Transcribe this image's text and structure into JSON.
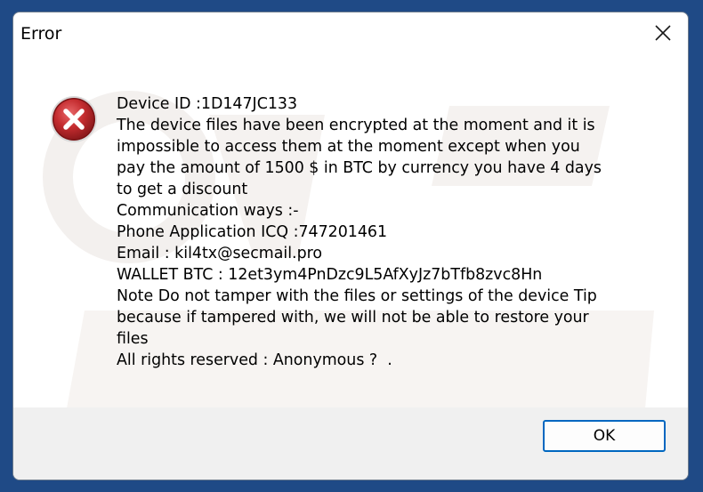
{
  "window": {
    "title": "Error",
    "close_icon": "close-icon"
  },
  "icon": {
    "name": "error-icon",
    "color": "#b3262a"
  },
  "message": {
    "lines": [
      "Device ID :1D147JC133",
      "The device files have been encrypted at the moment and it is",
      "impossible to access them at the moment except when you",
      "pay the amount of 1500 $ in BTC by currency you have 4 days",
      "to get a discount",
      "Communication ways :-",
      "Phone Application ICQ :747201461",
      "Email : kil4tx@secmail.pro",
      "WALLET BTC : 12et3ym4PnDzc9L5AfXyJz7bTfb8zvc8Hn",
      "Note Do not tamper with the files or settings of the device Tip",
      "because if tampered with, we will not be able to restore your",
      "files",
      "All rights reserved : Anonymous ?  ."
    ]
  },
  "buttons": {
    "ok_label": "OK"
  },
  "colors": {
    "accent": "#0067c0",
    "footer_bg": "#f0f0f0",
    "desktop_bg": "#1f4a86"
  }
}
